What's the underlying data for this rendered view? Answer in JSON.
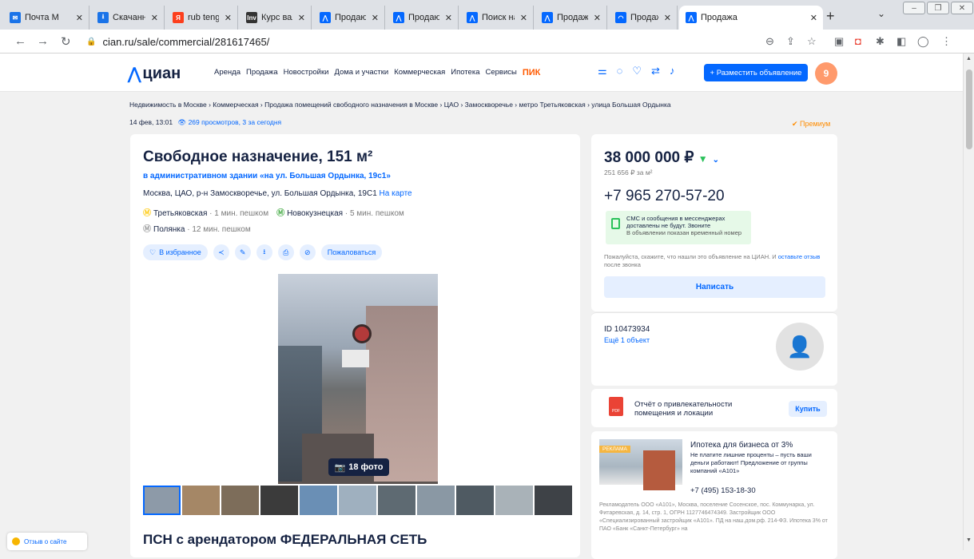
{
  "browser": {
    "tabs": [
      {
        "title": "Почта М",
        "icon": "mail-icon",
        "color": "#1a73e8",
        "glyph": "✉"
      },
      {
        "title": "Скачанн",
        "icon": "download-icon",
        "color": "#1a73e8",
        "glyph": "⭳"
      },
      {
        "title": "rub tenge",
        "icon": "yandex-icon",
        "color": "#fc3f1d",
        "glyph": "Я"
      },
      {
        "title": "Курс вал",
        "icon": "investing-icon",
        "color": "#333333",
        "glyph": "Inv"
      },
      {
        "title": "Продаю",
        "icon": "cian-icon",
        "color": "#0468ff",
        "glyph": "⋀"
      },
      {
        "title": "Продаю",
        "icon": "cian-icon",
        "color": "#0468ff",
        "glyph": "⋀"
      },
      {
        "title": "Поиск на",
        "icon": "cian-icon",
        "color": "#0468ff",
        "glyph": "⋀"
      },
      {
        "title": "Продажа",
        "icon": "cian-icon",
        "color": "#0468ff",
        "glyph": "⋀"
      },
      {
        "title": "Продажа",
        "icon": "cian-icon-alt",
        "color": "#0468ff",
        "glyph": "◠"
      },
      {
        "title": "Продажа",
        "icon": "cian-icon",
        "color": "#0468ff",
        "glyph": "⋀"
      }
    ],
    "url": "cian.ru/sale/commercial/281617465/"
  },
  "header": {
    "logo": "циан",
    "menu": [
      "Аренда",
      "Продажа",
      "Новостройки",
      "Дома и участки",
      "Коммерческая",
      "Ипотека",
      "Сервисы"
    ],
    "pik": "ПИК",
    "post_button": "+ Разместить объявление",
    "avatar_letter": "9"
  },
  "breadcrumbs": "Недвижимость в Москве  ›  Коммерческая  ›  Продажа помещений свободного назначения в Москве  ›  ЦАО  ›  Замоскворечье  ›  метро Третьяковская  ›  улица Большая Ордынка",
  "meta": {
    "date": "14 фев, 13:01",
    "views": "269 просмотров, 3 за сегодня",
    "premium": "Премиум"
  },
  "listing": {
    "title": "Свободное назначение, 151 м²",
    "building": "в административном здании «на ул. Большая Ордынка, 19с1»",
    "address": "Москва, ЦАО, р-н Замоскворечье, ул. Большая Ордынка, 19С1",
    "map_link": "На карте",
    "metro": [
      {
        "name": "Третьяковская",
        "dist": "· 1 мин. пешком",
        "color": "#ffcd1c"
      },
      {
        "name": "Новокузнецкая",
        "dist": "· 5 мин. пешком",
        "color": "#4fb04f"
      },
      {
        "name": "Полянка",
        "dist": "· 12 мин. пешком",
        "color": "#a1a2a3"
      }
    ],
    "favorite": "В избранное",
    "complain": "Пожаловаться",
    "photo_count": "18 фото",
    "subtitle": "ПСН с арендатором ФЕДЕРАЛЬНАЯ СЕТЬ"
  },
  "pricebox": {
    "price": "38 000 000 ₽",
    "per_m2": "251 656 ₽ за м²",
    "phone": "+7 965 270-57-20",
    "sms_line1": "СМС и сообщения в мессенджерах",
    "sms_line2": "доставлены не будут. Звоните",
    "sms_note": "В объявлении показан временный номер",
    "ask_text": "Пожалуйста, скажите, что нашли это объявление на ЦИАН. И",
    "ask_link": "оставьте отзыв",
    "ask_tail": "после звонка",
    "write": "Написать"
  },
  "agent": {
    "id": "ID 10473934",
    "more": "Ещё 1 объект"
  },
  "report": {
    "text": "Отчёт о привлекательности помещения и локации",
    "buy": "Купить"
  },
  "ad": {
    "tag": "РЕКЛАМА",
    "title": "Ипотека для бизнеса от 3%",
    "text": "Не платите лишние проценты – пусть ваши деньги работают! Предложение от группы компаний «А101»",
    "phone": "+7 (495) 153-18-30",
    "legal": "Рекламодатель ООО «А101», Москва, поселение Сосенское, пос. Коммунарка, ул. Фитаревская, д. 14, стр. 1, ОГРН 1127746474349. Застройщик ООО «Специализированный застройщик «А101». ПД на наш.дом.рф. 214-ФЗ. Ипотека 3% от ПАО «Банк «Санкт-Петербург» на"
  },
  "feedback": "Отзыв о сайте"
}
